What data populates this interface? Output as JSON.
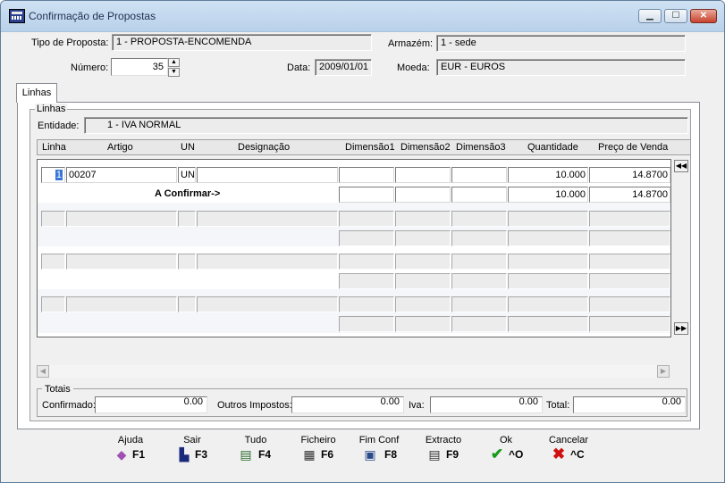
{
  "window": {
    "title": "Confirmação de Propostas"
  },
  "header": {
    "tipo_label": "Tipo de Proposta:",
    "tipo_value": "1 - PROPOSTA-ENCOMENDA",
    "armazem_label": "Armazém:",
    "armazem_value": "1 - sede",
    "numero_label": "Número:",
    "numero_value": "35",
    "data_label": "Data:",
    "data_value": "2009/01/01",
    "moeda_label": "Moeda:",
    "moeda_value": "EUR - EUROS"
  },
  "tabs": [
    {
      "label": "Linhas"
    }
  ],
  "linhas": {
    "group_title": "Linhas",
    "entidade_label": "Entidade:",
    "entidade_value": "1 - IVA NORMAL",
    "columns": [
      "Linha",
      "Artigo",
      "UN",
      "Designação",
      "Dimensão1",
      "Dimensão2",
      "Dimensão3",
      "Quantidade",
      "Preço de Venda"
    ],
    "rows": [
      {
        "linha": "1",
        "artigo": "00207",
        "un": "UN",
        "designacao": "",
        "quantidade": "10.000",
        "preco": "14.8700",
        "confirm_label": "A Confirmar->",
        "confirm_quantidade": "10.000",
        "confirm_preco": "14.8700"
      }
    ]
  },
  "totais": {
    "title": "Totais",
    "confirmado_label": "Confirmado:",
    "confirmado_value": "0.00",
    "outros_label": "Outros Impostos:",
    "outros_value": "0.00",
    "iva_label": "Iva:",
    "iva_value": "0.00",
    "total_label": "Total:",
    "total_value": "0.00"
  },
  "toolbar": [
    {
      "label": "Ajuda",
      "key": "F1",
      "icon": "book-icon"
    },
    {
      "label": "Sair",
      "key": "F3",
      "icon": "exit-icon"
    },
    {
      "label": "Tudo",
      "key": "F4",
      "icon": "document-check-icon"
    },
    {
      "label": "Ficheiro",
      "key": "F6",
      "icon": "file-cabinet-icon"
    },
    {
      "label": "Fim Conf",
      "key": "F8",
      "icon": "documents-icon"
    },
    {
      "label": "Extracto",
      "key": "F9",
      "icon": "document-icon"
    },
    {
      "label": "Ok",
      "key": "^O",
      "icon": "checkmark-icon"
    },
    {
      "label": "Cancelar",
      "key": "^C",
      "icon": "cross-icon"
    }
  ]
}
